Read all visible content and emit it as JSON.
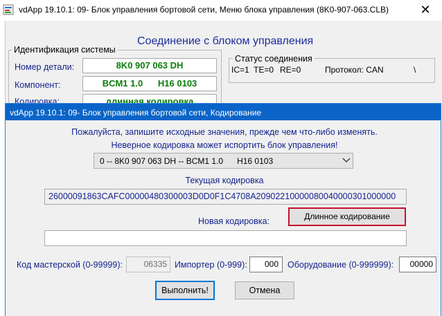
{
  "background_window": {
    "title": "vdApp 19.10.1: 09- Блок управления бортовой сети,  Меню блока управления (8K0-907-063.CLB)",
    "close_glyph": "✕",
    "heading": "Соединение с блоком управления",
    "identification": {
      "legend": "Идентификация системы",
      "part_number_label": "Номер детали:",
      "part_number_value": "8K0 907 063 DH",
      "component_label": "Компонент:",
      "component_value": "BCM1 1.0      H16 0103",
      "coding_label": "Кодировка:",
      "coding_value": "длинная кодировка"
    },
    "connection_status": {
      "legend": "Статус соединения",
      "ic": "IC=1",
      "te": "TE=0",
      "re": "RE=0",
      "protocol": "Протокол: CAN",
      "spinner": "\\"
    }
  },
  "dialog": {
    "title": "vdApp 19.10.1: 09- Блок управления бортовой сети,  Кодирование",
    "notice_line1": "Пожалуйста, запишите исходные значения, прежде чем что-либо изменять.",
    "notice_line2": "Неверное кодировка может испортить блок управления!",
    "variant_selected": "0 -- 8K0 907 063 DH -- BCM1 1.0      H16 0103",
    "current_coding_label": "Текущая кодировка",
    "current_coding_value": "26000091863CAFC00000480300003D0D0F1C4708A20902210000080040000301000000",
    "new_coding_label": "Новая кодировка:",
    "new_coding_value": "",
    "long_coding_button": "Длинное кодирование",
    "workshop_label": "Код мастерской (0-99999):",
    "workshop_value": "06335",
    "importer_label": "Импортер (0-999):",
    "importer_value": "000",
    "equipment_label": "Оборудование (0-999999):",
    "equipment_value": "00000",
    "execute_button": "Выполнить!",
    "cancel_button": "Отмена"
  },
  "colors": {
    "label_blue": "#14238e",
    "value_green": "#0a7d0a",
    "dialog_titlebar": "#0a64c8",
    "highlight_red": "#c8102e",
    "focus_blue": "#0078d7"
  },
  "icons": {
    "app": "app-icon",
    "close": "close-icon",
    "dropdown": "chevron-down-icon"
  }
}
